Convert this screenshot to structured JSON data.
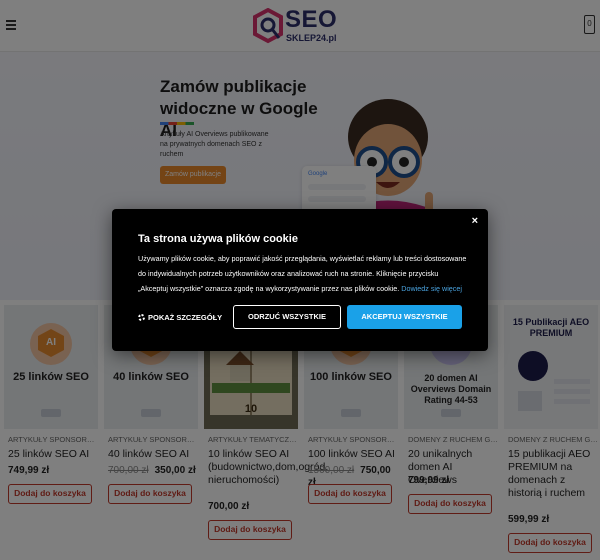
{
  "header": {
    "logo_main": "SEO",
    "logo_sub": "SKLEP24.pl",
    "cart_count": "0"
  },
  "hero": {
    "title": "Zamów publikacje widoczne w Google AI",
    "description": "Artykuły AI Overviews publikowane na prywatnych domenach SEO z ruchem",
    "button": "Zamów publikacje",
    "google_label": "Google",
    "google_item": "AI Overviews"
  },
  "cookie": {
    "title": "Ta strona używa plików cookie",
    "text": "Używamy plików cookie, aby poprawić jakość przeglądania, wyświetlać reklamy lub treści dostosowane do indywidualnych potrzeb użytkowników oraz analizować ruch na stronie. Kliknięcie przycisku „Akceptuj wszystkie” oznacza zgodę na wykorzystywanie przez nas plików cookie.",
    "link": "Dowiedz się więcej",
    "details": "POKAŻ SZCZEGÓŁY",
    "reject": "ODRZUĆ WSZYSTKIE",
    "accept": "AKCEPTUJ WSZYSTKIE",
    "close": "×"
  },
  "products": [
    {
      "img_label": "25 linków SEO",
      "img_icon": "AI",
      "category": "ARTYKUŁY SPONSOROWA...",
      "name": "25 linków SEO AI",
      "old_price": "",
      "price": "749,99 zł",
      "button": "Dodaj do koszyka"
    },
    {
      "img_label": "40 linków SEO",
      "img_icon": "AI",
      "category": "ARTYKUŁY SPONSOROWA...",
      "name": "40 linków SEO AI",
      "old_price": "700,00 zł",
      "price": "350,00 zł",
      "button": "Dodaj do koszyka"
    },
    {
      "img_label": "10",
      "img_icon": "",
      "category": "ARTYKUŁY TEMATYCZNE AI",
      "name": "10 linków SEO AI (budownictwo,dom,ogród, nieruchomości)",
      "old_price": "",
      "price": "700,00 zł",
      "button": "Dodaj do koszyka"
    },
    {
      "img_label": "100 linków SEO",
      "img_icon": "AI",
      "category": "ARTYKUŁY SPONSOROWA...",
      "name": "100 linków SEO AI",
      "old_price": "1500,00 zł",
      "price": "750,00 zł",
      "button": "Dodaj do koszyka"
    },
    {
      "img_label": "20 domen AI Overviews Domain Rating 44-53",
      "img_icon": "",
      "category": "DOMENY Z RUCHEM GOO...",
      "name": "20 unikalnych domen AI Overviews",
      "old_price": "",
      "price": "799,99 zł",
      "button": "Dodaj do koszyka"
    },
    {
      "img_label": "15 Publikacji AEO PREMIUM",
      "img_icon": "",
      "category": "DOMENY Z RUCHEM GOO...",
      "name": "15 publikacji AEO PREMIUM na domenach z historią i ruchem",
      "old_price": "",
      "price": "599,99 zł",
      "button": "Dodaj do koszyka"
    }
  ]
}
